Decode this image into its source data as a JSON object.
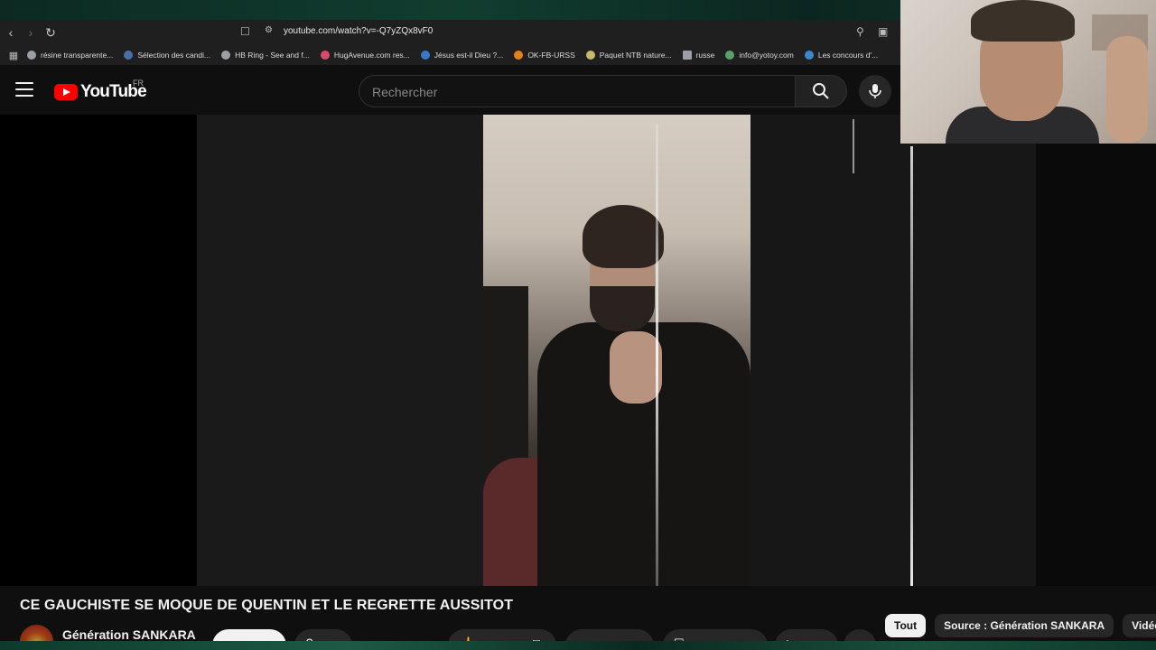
{
  "browser": {
    "url": "youtube.com/watch?v=-Q7yZQx8vF0",
    "bookmarks": [
      {
        "label": "résine transparente...",
        "color": "#9aa0a6"
      },
      {
        "label": "Sélection des candi...",
        "color": "#4a6fa5"
      },
      {
        "label": "HB Ring - See and f...",
        "color": "#9aa0a6"
      },
      {
        "label": "HugAvenue.com res...",
        "color": "#d44c6a"
      },
      {
        "label": "Jésus est-il Dieu ?...",
        "color": "#3a78c8"
      },
      {
        "label": "OK-FB-URSS",
        "color": "#e2811a"
      },
      {
        "label": "Paquet NTB nature...",
        "color": "#c7b86a"
      },
      {
        "label": "russe",
        "color": "#9aa0a6"
      },
      {
        "label": "info@yotoy.com",
        "color": "#59a16a"
      },
      {
        "label": "Les concours d'...",
        "color": "#3d86c8"
      }
    ]
  },
  "header": {
    "logo_text": "YouTube",
    "country_code": "FR",
    "search_placeholder": "Rechercher"
  },
  "video": {
    "title": "CE GAUCHISTE SE MOQUE DE QUENTIN ET LE REGRETTE AUSSITOT",
    "channel_name": "Génération SANKARA"
  },
  "chips": [
    {
      "label": "Tout",
      "active": true
    },
    {
      "label": "Source : Génération SANKARA",
      "active": false
    },
    {
      "label": "Vidéo",
      "active": false
    }
  ],
  "colors": {
    "background": "#0f0f0f",
    "brand_red": "#ff0000",
    "chip_bg": "#272727",
    "text": "#f1f1f1"
  }
}
